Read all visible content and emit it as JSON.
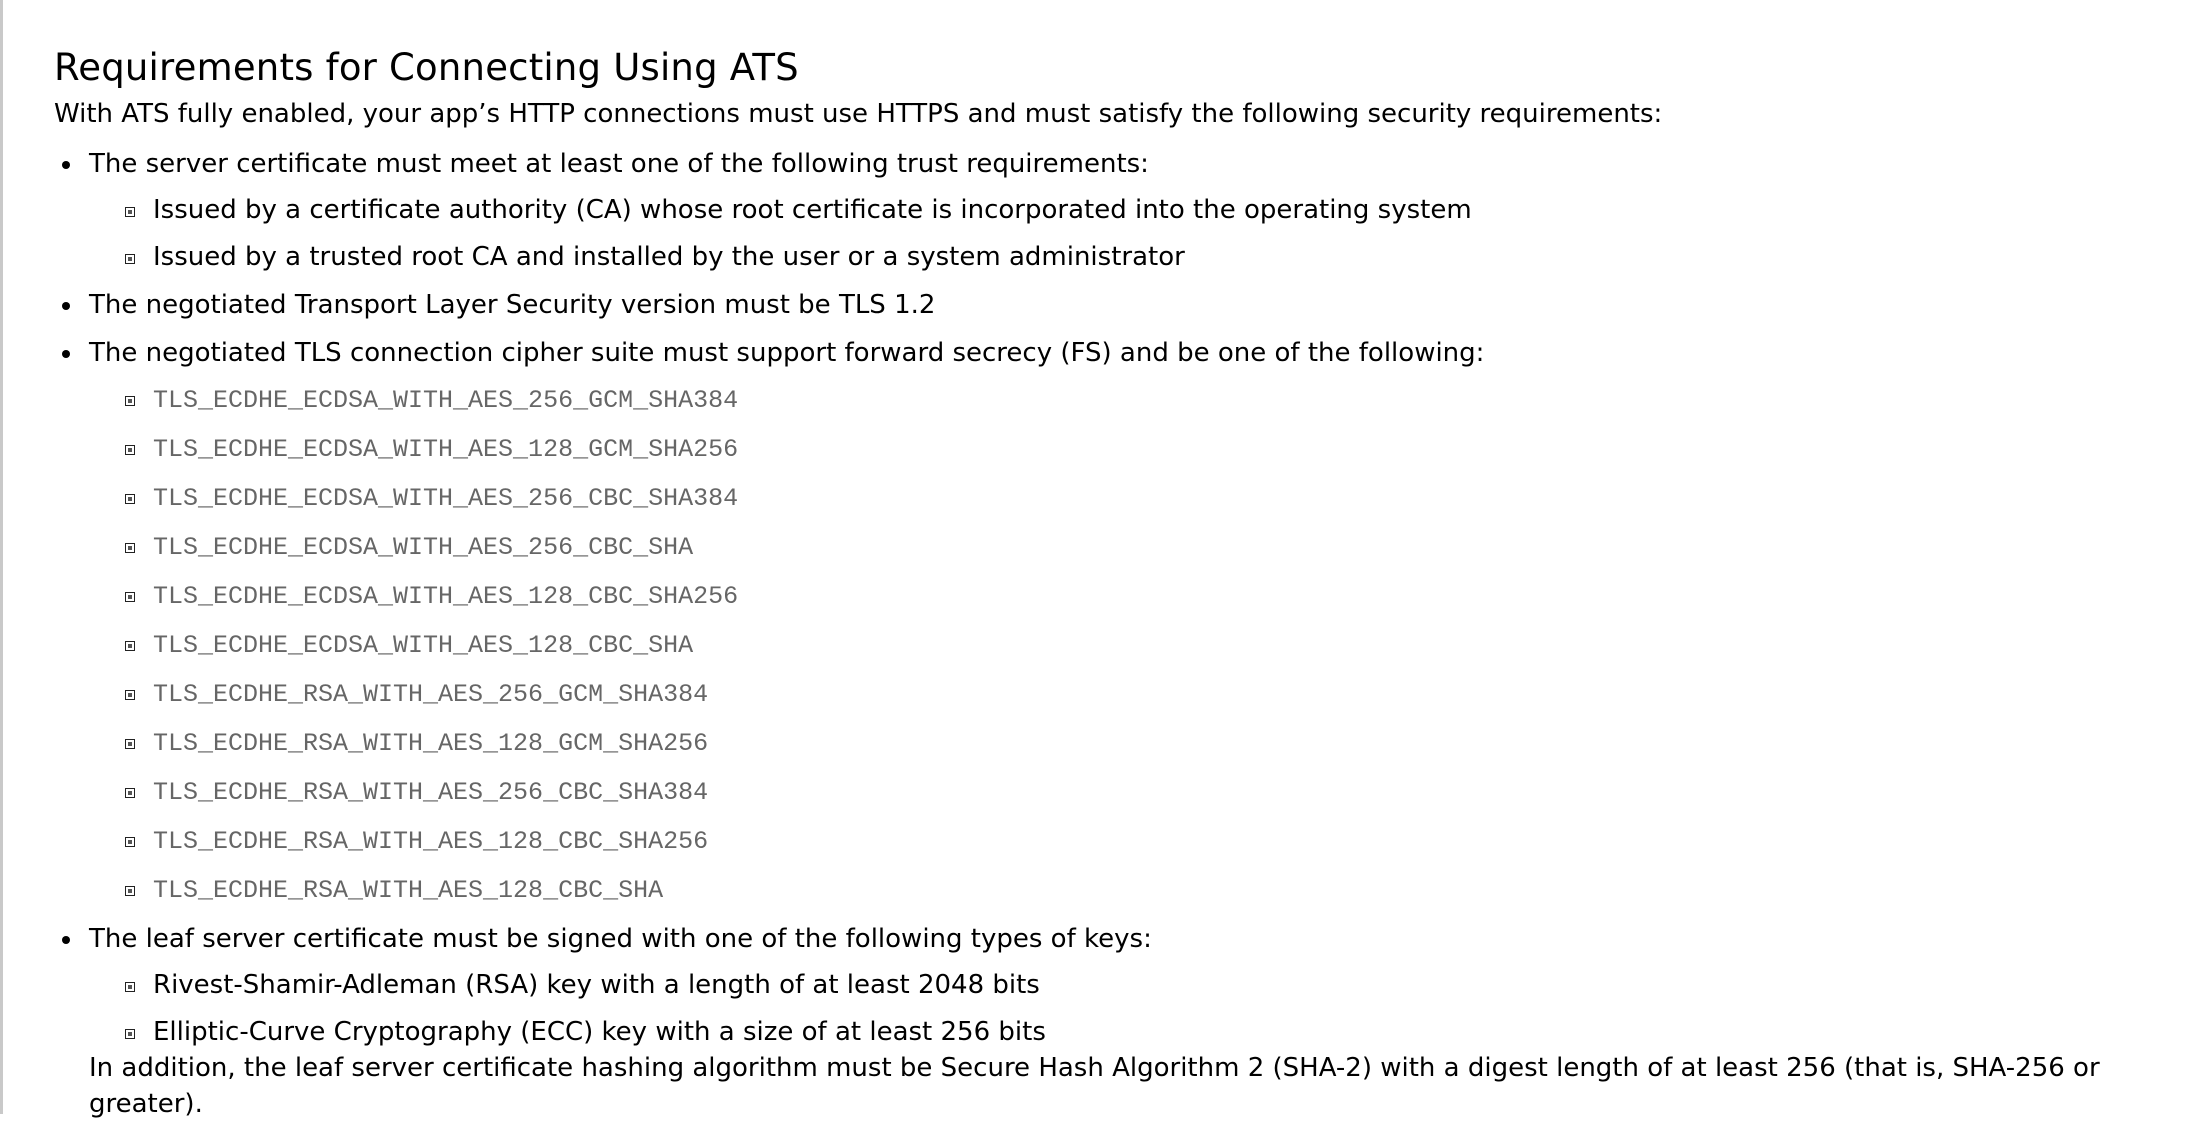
{
  "doc": {
    "title": "Requirements for Connecting Using ATS",
    "intro": "With ATS fully enabled, your app’s HTTP connections must use HTTPS and must satisfy the following security requirements:",
    "requirements": [
      {
        "text": "The server certificate must meet at least one of the following trust requirements:",
        "sub": [
          "Issued by a certificate authority (CA) whose root certificate is incorporated into the operating system",
          "Issued by a trusted root CA and installed by the user or a system administrator"
        ]
      },
      {
        "text": "The negotiated Transport Layer Security version must be TLS 1.2"
      },
      {
        "text": "The negotiated TLS connection cipher suite must support forward secrecy (FS) and be one of the following:",
        "sub": [
          "TLS_ECDHE_ECDSA_WITH_AES_256_GCM_SHA384",
          "TLS_ECDHE_ECDSA_WITH_AES_128_GCM_SHA256",
          "TLS_ECDHE_ECDSA_WITH_AES_256_CBC_SHA384",
          "TLS_ECDHE_ECDSA_WITH_AES_256_CBC_SHA",
          "TLS_ECDHE_ECDSA_WITH_AES_128_CBC_SHA256",
          "TLS_ECDHE_ECDSA_WITH_AES_128_CBC_SHA",
          "TLS_ECDHE_RSA_WITH_AES_256_GCM_SHA384",
          "TLS_ECDHE_RSA_WITH_AES_128_GCM_SHA256",
          "TLS_ECDHE_RSA_WITH_AES_256_CBC_SHA384",
          "TLS_ECDHE_RSA_WITH_AES_128_CBC_SHA256",
          "TLS_ECDHE_RSA_WITH_AES_128_CBC_SHA"
        ]
      },
      {
        "text": "The leaf server certificate must be signed with one of the following types of keys:",
        "sub": [
          "Rivest-Shamir-Adleman (RSA) key with a length of at least 2048 bits",
          "Elliptic-Curve Cryptography (ECC) key with a size of at least 256 bits"
        ],
        "note": "In addition, the leaf server certificate hashing algorithm must be Secure Hash Algorithm 2 (SHA-2) with a digest length of at least 256 (that is, SHA-256 or greater)."
      }
    ]
  }
}
